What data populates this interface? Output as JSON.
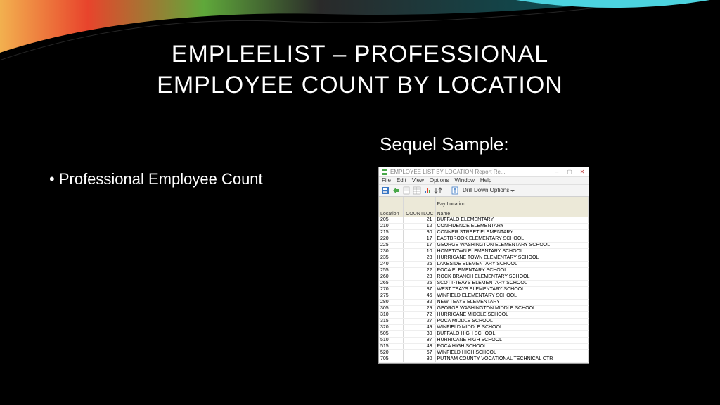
{
  "title_line1": "EMPLEELIST – PROFESSIONAL",
  "title_line2": "EMPLOYEE COUNT BY LOCATION",
  "bullet": "Professional Employee Count",
  "sequel_label": "Sequel Sample:",
  "window": {
    "title": "EMPLOYEE LIST BY LOCATION Report Re...",
    "menu": [
      "File",
      "Edit",
      "View",
      "Options",
      "Window",
      "Help"
    ],
    "drilldown": "Drill Down Options",
    "headers": {
      "loc": "Location",
      "cnt": "COUNTLOC",
      "name_top": "Pay Location",
      "name_bot": "Name"
    },
    "rows": [
      {
        "loc": "205",
        "cnt": "21",
        "name": "BUFFALO ELEMENTARY"
      },
      {
        "loc": "210",
        "cnt": "12",
        "name": "CONFIDENCE ELEMENTARY"
      },
      {
        "loc": "215",
        "cnt": "30",
        "name": "CONNER STREET ELEMENTARY"
      },
      {
        "loc": "220",
        "cnt": "17",
        "name": "EASTBROOK ELEMENTARY SCHOOL"
      },
      {
        "loc": "225",
        "cnt": "17",
        "name": "GEORGE WASHINGTON ELEMENTARY SCHOOL"
      },
      {
        "loc": "230",
        "cnt": "10",
        "name": "HOMETOWN ELEMENTARY SCHOOL"
      },
      {
        "loc": "235",
        "cnt": "23",
        "name": "HURRICANE TOWN ELEMENTARY SCHOOL"
      },
      {
        "loc": "240",
        "cnt": "26",
        "name": "LAKESIDE ELEMENTARY SCHOOL"
      },
      {
        "loc": "255",
        "cnt": "22",
        "name": "POCA ELEMENTARY SCHOOL"
      },
      {
        "loc": "260",
        "cnt": "23",
        "name": "ROCK BRANCH ELEMENTARY SCHOOL"
      },
      {
        "loc": "265",
        "cnt": "25",
        "name": "SCOTT-TEAYS ELEMENTARY SCHOOL"
      },
      {
        "loc": "270",
        "cnt": "37",
        "name": "WEST TEAYS ELEMENTARY SCHOOL"
      },
      {
        "loc": "275",
        "cnt": "46",
        "name": "WINFIELD ELEMENTARY SCHOOL"
      },
      {
        "loc": "280",
        "cnt": "32",
        "name": "NEW TEAYS ELEMENTARY"
      },
      {
        "loc": "305",
        "cnt": "29",
        "name": "GEORGE WASHINGTON MIDDLE SCHOOL"
      },
      {
        "loc": "310",
        "cnt": "72",
        "name": "HURRICANE MIDDLE SCHOOL"
      },
      {
        "loc": "315",
        "cnt": "27",
        "name": "POCA MIDDLE SCHOOL"
      },
      {
        "loc": "320",
        "cnt": "49",
        "name": "WINFIELD MIDDLE SCHOOL"
      },
      {
        "loc": "505",
        "cnt": "30",
        "name": "BUFFALO HIGH SCHOOL"
      },
      {
        "loc": "510",
        "cnt": "87",
        "name": "HURRICANE HIGH SCHOOL"
      },
      {
        "loc": "515",
        "cnt": "43",
        "name": "POCA HIGH SCHOOL"
      },
      {
        "loc": "520",
        "cnt": "67",
        "name": "WINFIELD HIGH SCHOOL"
      },
      {
        "loc": "705",
        "cnt": "30",
        "name": "PUTNAM COUNTY VOCATIONAL TECHNICAL CTR"
      }
    ]
  }
}
